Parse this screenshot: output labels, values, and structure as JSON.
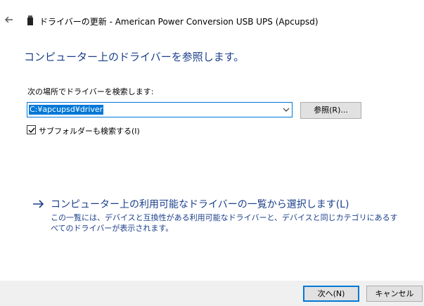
{
  "window": {
    "title": "ドライバーの更新 - American Power Conversion USB UPS (Apcupsd)"
  },
  "main": {
    "heading": "コンピューター上のドライバーを参照します。",
    "search_label": "次の場所でドライバーを検索します:",
    "path_value": "C:¥apcupsd¥driver",
    "browse_label": "参照(R)...",
    "include_subfolders_label": "サブフォルダーも検索する(I)",
    "include_subfolders_checked": true,
    "pick_link": "コンピューター上の利用可能なドライバーの一覧から選択します(L)",
    "pick_desc": "この一覧には、デバイスと互換性がある利用可能なドライバーと、デバイスと同じカテゴリにあるすべてのドライバーが表示されます。"
  },
  "footer": {
    "next_label": "次へ(N)",
    "cancel_label": "キャンセル"
  },
  "colors": {
    "accent": "#0078d7",
    "heading": "#1b3f8b",
    "footer_bg": "#f0f0f0"
  },
  "icons": {
    "back": "back-arrow-icon",
    "device": "usb-device-icon",
    "combo": "chevron-down-icon",
    "check": "checkmark-icon",
    "link_arrow": "right-arrow-icon"
  }
}
